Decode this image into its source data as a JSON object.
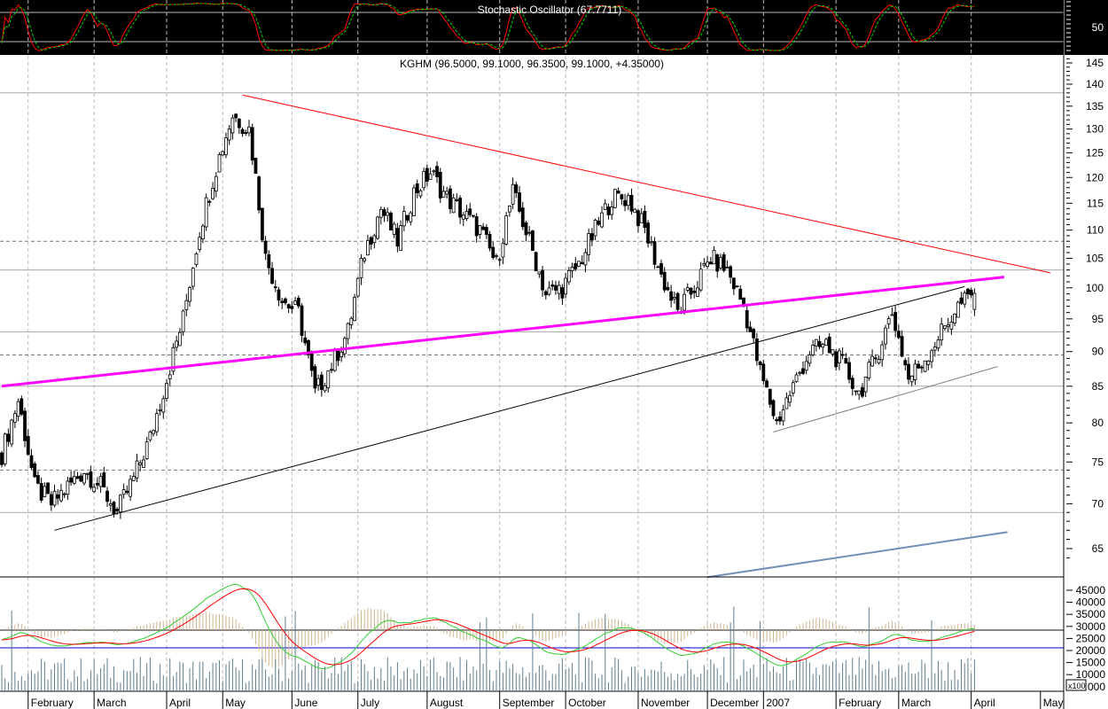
{
  "chart_data": {
    "type": "candlestick",
    "symbol": "KGHM",
    "title": "KGHM (96.5000, 99.1000, 96.3500, 99.1000, +4.35000)",
    "stochastic_title": "Stochastic Oscillator (67.7711)",
    "stochastic_ticks": [
      "50"
    ],
    "price_scale": "log",
    "ylim": [
      62,
      147
    ],
    "price_ticks": [
      145,
      140,
      135,
      130,
      125,
      120,
      115,
      110,
      105,
      100,
      95,
      90,
      85,
      80,
      75,
      70,
      65
    ],
    "volume_ticks": [
      "45000",
      "40000",
      "35000",
      "30000",
      "25000",
      "20000",
      "15000",
      "10000",
      "000"
    ],
    "volume_multiplier": "x100",
    "month_labels": [
      {
        "label": "February",
        "day": 8
      },
      {
        "label": "March",
        "day": 28
      },
      {
        "label": "April",
        "day": 50
      },
      {
        "label": "May",
        "day": 67
      },
      {
        "label": "June",
        "day": 88
      },
      {
        "label": "July",
        "day": 108
      },
      {
        "label": "August",
        "day": 129
      },
      {
        "label": "September",
        "day": 151
      },
      {
        "label": "October",
        "day": 171
      },
      {
        "label": "November",
        "day": 193
      },
      {
        "label": "December",
        "day": 214
      },
      {
        "label": "2007",
        "day": 231
      },
      {
        "label": "February",
        "day": 253
      },
      {
        "label": "March",
        "day": 272
      },
      {
        "label": "April",
        "day": 294
      },
      {
        "label": "May",
        "day": 315
      }
    ],
    "weekly_close_step_days": 5,
    "weekly_close": [
      76,
      83,
      72,
      70,
      72,
      74,
      72,
      69,
      73,
      78,
      86,
      95,
      110,
      122,
      133,
      130,
      105,
      98,
      96,
      84,
      88,
      93,
      106,
      114,
      108,
      117,
      121,
      116,
      113,
      110,
      104,
      117,
      108,
      99,
      100,
      104,
      110,
      116,
      116,
      110,
      102,
      96,
      100,
      105,
      103,
      97,
      87,
      80,
      85,
      90,
      91,
      88,
      84,
      89,
      96,
      86,
      89,
      93,
      97,
      99
    ],
    "last_candle": {
      "open": 96.5,
      "high": 99.1,
      "low": 96.35,
      "close": 99.1,
      "change": 4.35
    },
    "horizontal_lines": [
      {
        "price": 138,
        "style": "solid"
      },
      {
        "price": 108,
        "style": "dashed"
      },
      {
        "price": 103,
        "style": "solid"
      },
      {
        "price": 93,
        "style": "solid"
      },
      {
        "price": 89.5,
        "style": "dashed"
      },
      {
        "price": 85,
        "style": "solid"
      },
      {
        "price": 74,
        "style": "dashed"
      },
      {
        "price": 69,
        "style": "solid"
      }
    ],
    "trendlines": [
      {
        "name": "resistance",
        "color": "#ff0000",
        "from": [
          73,
          137.5
        ],
        "to": [
          318,
          102.5
        ],
        "width": 1
      },
      {
        "name": "magenta-support",
        "color": "#ff00ff",
        "from": [
          0,
          85
        ],
        "to": [
          304,
          101.8
        ],
        "width": 3
      },
      {
        "name": "main-uptrend",
        "color": "#000000",
        "from": [
          16,
          67
        ],
        "to": [
          292,
          100.2
        ],
        "width": 1
      },
      {
        "name": "channel-bottom",
        "color": "#808080",
        "from": [
          234,
          78.8
        ],
        "to": [
          302,
          87.8
        ],
        "width": 1
      },
      {
        "name": "lower-channel",
        "color": "#7090b8",
        "from": [
          214,
          62
        ],
        "to": [
          305,
          66.8
        ],
        "width": 2
      }
    ],
    "colors": {
      "stoch_k": "#ff0000",
      "stoch_d": "#00dd00",
      "macd": "#33cc33",
      "signal": "#ff0000",
      "histogram": "#d2b48c",
      "volume": "#5f7f8f",
      "baseline": "#0000cc"
    }
  }
}
